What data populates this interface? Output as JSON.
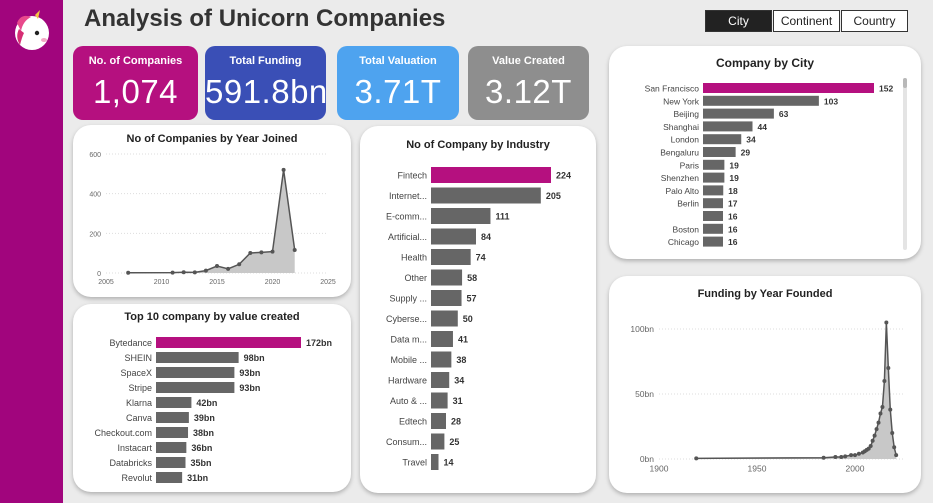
{
  "page": {
    "title": "Analysis of Unicorn Companies"
  },
  "filters": [
    {
      "label": "City",
      "active": true
    },
    {
      "label": "Continent",
      "active": false
    },
    {
      "label": "Country",
      "active": false
    }
  ],
  "kpis": [
    {
      "label": "No. of Companies",
      "value": "1,074",
      "color": "#b5107f"
    },
    {
      "label": "Total Funding",
      "value": "591.8bn",
      "color": "#3a4fb6"
    },
    {
      "label": "Total Valuation",
      "value": "3.71T",
      "color": "#4ea3ef"
    },
    {
      "label": "Value Created",
      "value": "3.12T",
      "color": "#8e8e8e"
    }
  ],
  "colors": {
    "accent": "#b5107f",
    "bar": "#666666",
    "sidebar": "#a1057d"
  },
  "chart_data": [
    {
      "id": "year_joined",
      "type": "area",
      "title": "No of Companies by Year Joined",
      "x": [
        2007,
        2011,
        2012,
        2013,
        2014,
        2015,
        2016,
        2017,
        2018,
        2019,
        2020,
        2021,
        2022
      ],
      "y": [
        1,
        2,
        4,
        3,
        12,
        35,
        21,
        44,
        101,
        104,
        108,
        520,
        116
      ],
      "xlim": [
        2005,
        2025
      ],
      "ylim": [
        0,
        600
      ],
      "xticks": [
        2005,
        2010,
        2015,
        2020,
        2025
      ],
      "yticks": [
        0,
        200,
        400,
        600
      ]
    },
    {
      "id": "top10",
      "type": "bar",
      "title": "Top 10 company by value created",
      "categories": [
        "Bytedance",
        "SHEIN",
        "SpaceX",
        "Stripe",
        "Klarna",
        "Canva",
        "Checkout.com",
        "Instacart",
        "Databricks",
        "Revolut"
      ],
      "values": [
        172,
        98,
        93,
        93,
        42,
        39,
        38,
        36,
        35,
        31
      ],
      "labels": [
        "172bn",
        "98bn",
        "93bn",
        "93bn",
        "42bn",
        "39bn",
        "38bn",
        "36bn",
        "35bn",
        "31bn"
      ]
    },
    {
      "id": "industry",
      "type": "bar",
      "title": "No of Company by Industry",
      "categories": [
        "Fintech",
        "Internet...",
        "E-comm...",
        "Artificial...",
        "Health",
        "Other",
        "Supply ...",
        "Cyberse...",
        "Data m...",
        "Mobile ...",
        "Hardware",
        "Auto & ...",
        "Edtech",
        "Consum...",
        "Travel"
      ],
      "values": [
        224,
        205,
        111,
        84,
        74,
        58,
        57,
        50,
        41,
        38,
        34,
        31,
        28,
        25,
        14
      ]
    },
    {
      "id": "city",
      "type": "bar",
      "title": "Company by City",
      "categories": [
        "San Francisco",
        "New York",
        "Beijing",
        "Shanghai",
        "London",
        "Bengaluru",
        "Paris",
        "Shenzhen",
        "Palo Alto",
        "Berlin",
        "",
        "Boston",
        "Chicago"
      ],
      "values": [
        152,
        103,
        63,
        44,
        34,
        29,
        19,
        19,
        18,
        17,
        16,
        16,
        16
      ]
    },
    {
      "id": "funding_founded",
      "type": "area",
      "title": "Funding by Year Founded",
      "x": [
        1919,
        1984,
        1990,
        1993,
        1995,
        1998,
        2000,
        2002,
        2004,
        2005,
        2006,
        2007,
        2008,
        2009,
        2010,
        2011,
        2012,
        2013,
        2014,
        2015,
        2016,
        2017,
        2018,
        2019,
        2020,
        2021
      ],
      "y": [
        0.5,
        1,
        1.5,
        1.5,
        2,
        3,
        3,
        4,
        5,
        6,
        7,
        8,
        10,
        14,
        18,
        23,
        28,
        35,
        40,
        60,
        105,
        70,
        38,
        20,
        9,
        3
      ],
      "xlim": [
        1900,
        2025
      ],
      "ylim": [
        0,
        110
      ],
      "xticks": [
        1900,
        1950,
        2000
      ],
      "yticks": [
        0,
        50,
        100
      ],
      "ytick_labels": [
        "0bn",
        "50bn",
        "100bn"
      ]
    }
  ]
}
